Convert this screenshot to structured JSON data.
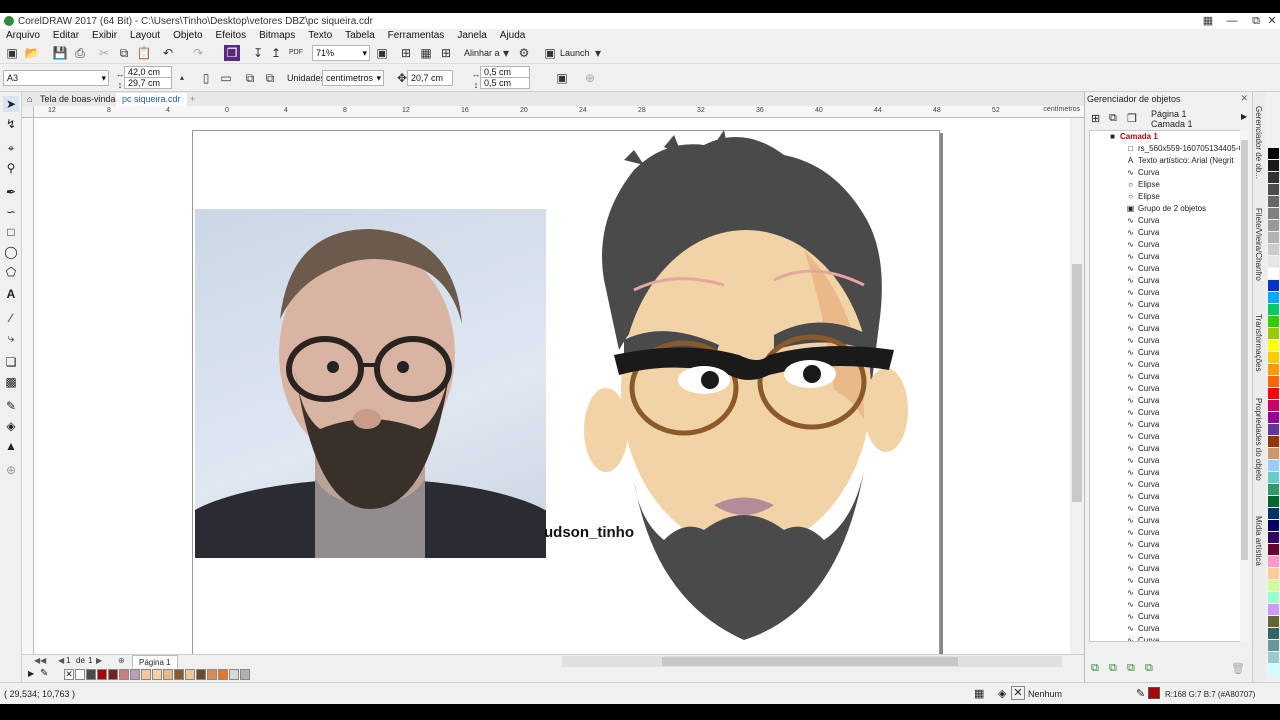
{
  "window": {
    "title": "CorelDRAW 2017 (64 Bit) - C:\\Users\\Tinho\\Desktop\\vetores DBZ\\pc siqueira.cdr"
  },
  "menu": [
    "Arquivo",
    "Editar",
    "Exibir",
    "Layout",
    "Objeto",
    "Efeitos",
    "Bitmaps",
    "Texto",
    "Tabela",
    "Ferramentas",
    "Janela",
    "Ajuda"
  ],
  "toolbar": {
    "zoom": "71%",
    "align_label": "Alinhar a",
    "launch_label": "Launch"
  },
  "property_bar": {
    "page_size": "A3",
    "width": "42,0 cm",
    "height": "29,7 cm",
    "units_label": "Unidades:",
    "units_value": "centímetros",
    "nudge": "20,7 cm",
    "dup_x": "0,5 cm",
    "dup_y": "0,5 cm"
  },
  "doc_tabs": [
    "Tela de boas-vindas",
    "pc siqueira.cdr"
  ],
  "ruler": {
    "unit": "centímetros",
    "h_ticks": [
      "12",
      "8",
      "4",
      "0",
      "4",
      "8",
      "12",
      "16",
      "20",
      "24",
      "28",
      "32",
      "36",
      "40",
      "44",
      "48",
      "52"
    ]
  },
  "canvas": {
    "caption": "udson_tinho"
  },
  "page_nav": {
    "current": "1",
    "of_label": "de",
    "total": "1",
    "page_tab": "Página 1"
  },
  "status": {
    "coords": "( 29,534; 10,763 )",
    "fill_label": "Nenhum",
    "color_info": "R:168 G:7 B:7 (#A80707)"
  },
  "object_manager": {
    "title": "Gerenciador de objetos",
    "page_label": "Página 1",
    "layer_label": "Camada 1",
    "items": [
      {
        "label": "Camada 1",
        "icon": "layer",
        "indent": 0,
        "highlight": true
      },
      {
        "label": "rs_560x559-160705134405-C",
        "icon": "bitmap",
        "indent": 1
      },
      {
        "label": "Texto artístico: Arial (Negrit",
        "icon": "text",
        "indent": 1
      },
      {
        "label": "Curva",
        "icon": "curve",
        "indent": 1
      },
      {
        "label": "Elipse",
        "icon": "ellipse",
        "indent": 1
      },
      {
        "label": "Elipse",
        "icon": "ellipse",
        "indent": 1
      },
      {
        "label": "Grupo de 2 objetos",
        "icon": "group",
        "indent": 1
      },
      {
        "label": "Curva",
        "icon": "curve",
        "indent": 1
      },
      {
        "label": "Curva",
        "icon": "curve",
        "indent": 1
      },
      {
        "label": "Curva",
        "icon": "curve",
        "indent": 1
      },
      {
        "label": "Curva",
        "icon": "curve",
        "indent": 1
      },
      {
        "label": "Curva",
        "icon": "curve",
        "indent": 1
      },
      {
        "label": "Curva",
        "icon": "curve",
        "indent": 1
      },
      {
        "label": "Curva",
        "icon": "curve",
        "indent": 1
      },
      {
        "label": "Curva",
        "icon": "curve",
        "indent": 1
      },
      {
        "label": "Curva",
        "icon": "curve",
        "indent": 1
      },
      {
        "label": "Curva",
        "icon": "curve",
        "indent": 1
      },
      {
        "label": "Curva",
        "icon": "curve",
        "indent": 1
      },
      {
        "label": "Curva",
        "icon": "curve",
        "indent": 1
      },
      {
        "label": "Curva",
        "icon": "curve",
        "indent": 1
      },
      {
        "label": "Curva",
        "icon": "curve",
        "indent": 1
      },
      {
        "label": "Curva",
        "icon": "curve",
        "indent": 1
      },
      {
        "label": "Curva",
        "icon": "curve",
        "indent": 1
      },
      {
        "label": "Curva",
        "icon": "curve",
        "indent": 1
      },
      {
        "label": "Curva",
        "icon": "curve",
        "indent": 1
      },
      {
        "label": "Curva",
        "icon": "curve",
        "indent": 1
      },
      {
        "label": "Curva",
        "icon": "curve",
        "indent": 1
      },
      {
        "label": "Curva",
        "icon": "curve",
        "indent": 1
      },
      {
        "label": "Curva",
        "icon": "curve",
        "indent": 1
      },
      {
        "label": "Curva",
        "icon": "curve",
        "indent": 1
      },
      {
        "label": "Curva",
        "icon": "curve",
        "indent": 1
      },
      {
        "label": "Curva",
        "icon": "curve",
        "indent": 1
      },
      {
        "label": "Curva",
        "icon": "curve",
        "indent": 1
      },
      {
        "label": "Curva",
        "icon": "curve",
        "indent": 1
      },
      {
        "label": "Curva",
        "icon": "curve",
        "indent": 1
      },
      {
        "label": "Curva",
        "icon": "curve",
        "indent": 1
      },
      {
        "label": "Curva",
        "icon": "curve",
        "indent": 1
      },
      {
        "label": "Curva",
        "icon": "curve",
        "indent": 1
      },
      {
        "label": "Curva",
        "icon": "curve",
        "indent": 1
      },
      {
        "label": "Curva",
        "icon": "curve",
        "indent": 1
      },
      {
        "label": "Curva",
        "icon": "curve",
        "indent": 1
      },
      {
        "label": "Curva",
        "icon": "curve",
        "indent": 1
      },
      {
        "label": "Curva",
        "icon": "curve",
        "indent": 1
      }
    ]
  },
  "side_tabs": [
    "Gerenciador de ob...",
    "Filete/Vieira/Chanfro",
    "Transformações",
    "Propriedades do objeto",
    "Mídia artística"
  ],
  "document_palette": [
    "#ffffff",
    "#4a4a4a",
    "#a80707",
    "#7a1e1e",
    "#c98080",
    "#b5a0b0",
    "#f5c7a0",
    "#f1d3a6",
    "#e9b98a",
    "#8b5a2b",
    "#e8c89a",
    "#6b4a2a",
    "#d48a5a",
    "#e87722",
    "#d8d8d8",
    "#b0b0b0"
  ],
  "color_palette": [
    "#000000",
    "#1a1a1a",
    "#333333",
    "#4d4d4d",
    "#666666",
    "#808080",
    "#999999",
    "#b3b3b3",
    "#cccccc",
    "#e6e6e6",
    "#ffffff",
    "#0033cc",
    "#00aaff",
    "#00cc66",
    "#33cc00",
    "#99cc00",
    "#ffff00",
    "#ffcc00",
    "#ff9900",
    "#ff6600",
    "#ff0000",
    "#cc0066",
    "#990099",
    "#663399",
    "#993300",
    "#cc9966",
    "#99ccff",
    "#66cccc",
    "#339966",
    "#006633",
    "#003366",
    "#000066",
    "#330066",
    "#660033",
    "#ff99cc",
    "#ffcc99",
    "#ccff99",
    "#99ffcc",
    "#cc99ff",
    "#666633",
    "#336666",
    "#669999",
    "#99cccc",
    "#ccffff"
  ]
}
